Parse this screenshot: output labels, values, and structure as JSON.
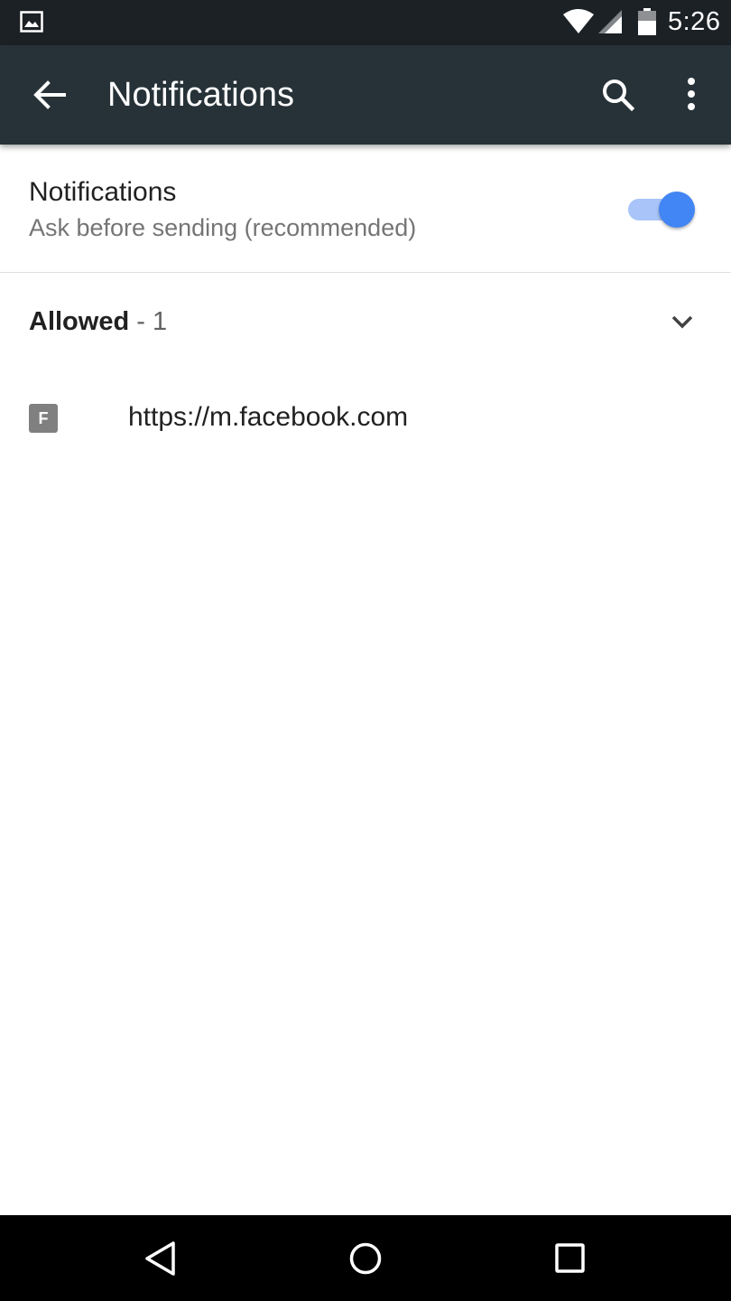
{
  "status_bar": {
    "time": "5:26",
    "icons": [
      "image-notification-icon",
      "wifi-icon",
      "signal-icon",
      "battery-icon"
    ]
  },
  "app_bar": {
    "title": "Notifications",
    "back_icon": "arrow-back-icon",
    "search_icon": "search-icon",
    "overflow_icon": "more-vert-icon"
  },
  "setting": {
    "title": "Notifications",
    "summary": "Ask before sending (recommended)",
    "enabled": true
  },
  "allowed": {
    "label": "Allowed",
    "count_text": " - 1",
    "expand_icon": "chevron-down-icon"
  },
  "sites": [
    {
      "favicon_letter": "F",
      "url": "https://m.facebook.com"
    }
  ],
  "nav_bar": {
    "icons": [
      "nav-back-icon",
      "nav-home-icon",
      "nav-recents-icon"
    ]
  },
  "colors": {
    "status_bar": "#1c2126",
    "app_bar": "#263238",
    "accent": "#4285f4",
    "accent_track": "#a8c4f8"
  }
}
